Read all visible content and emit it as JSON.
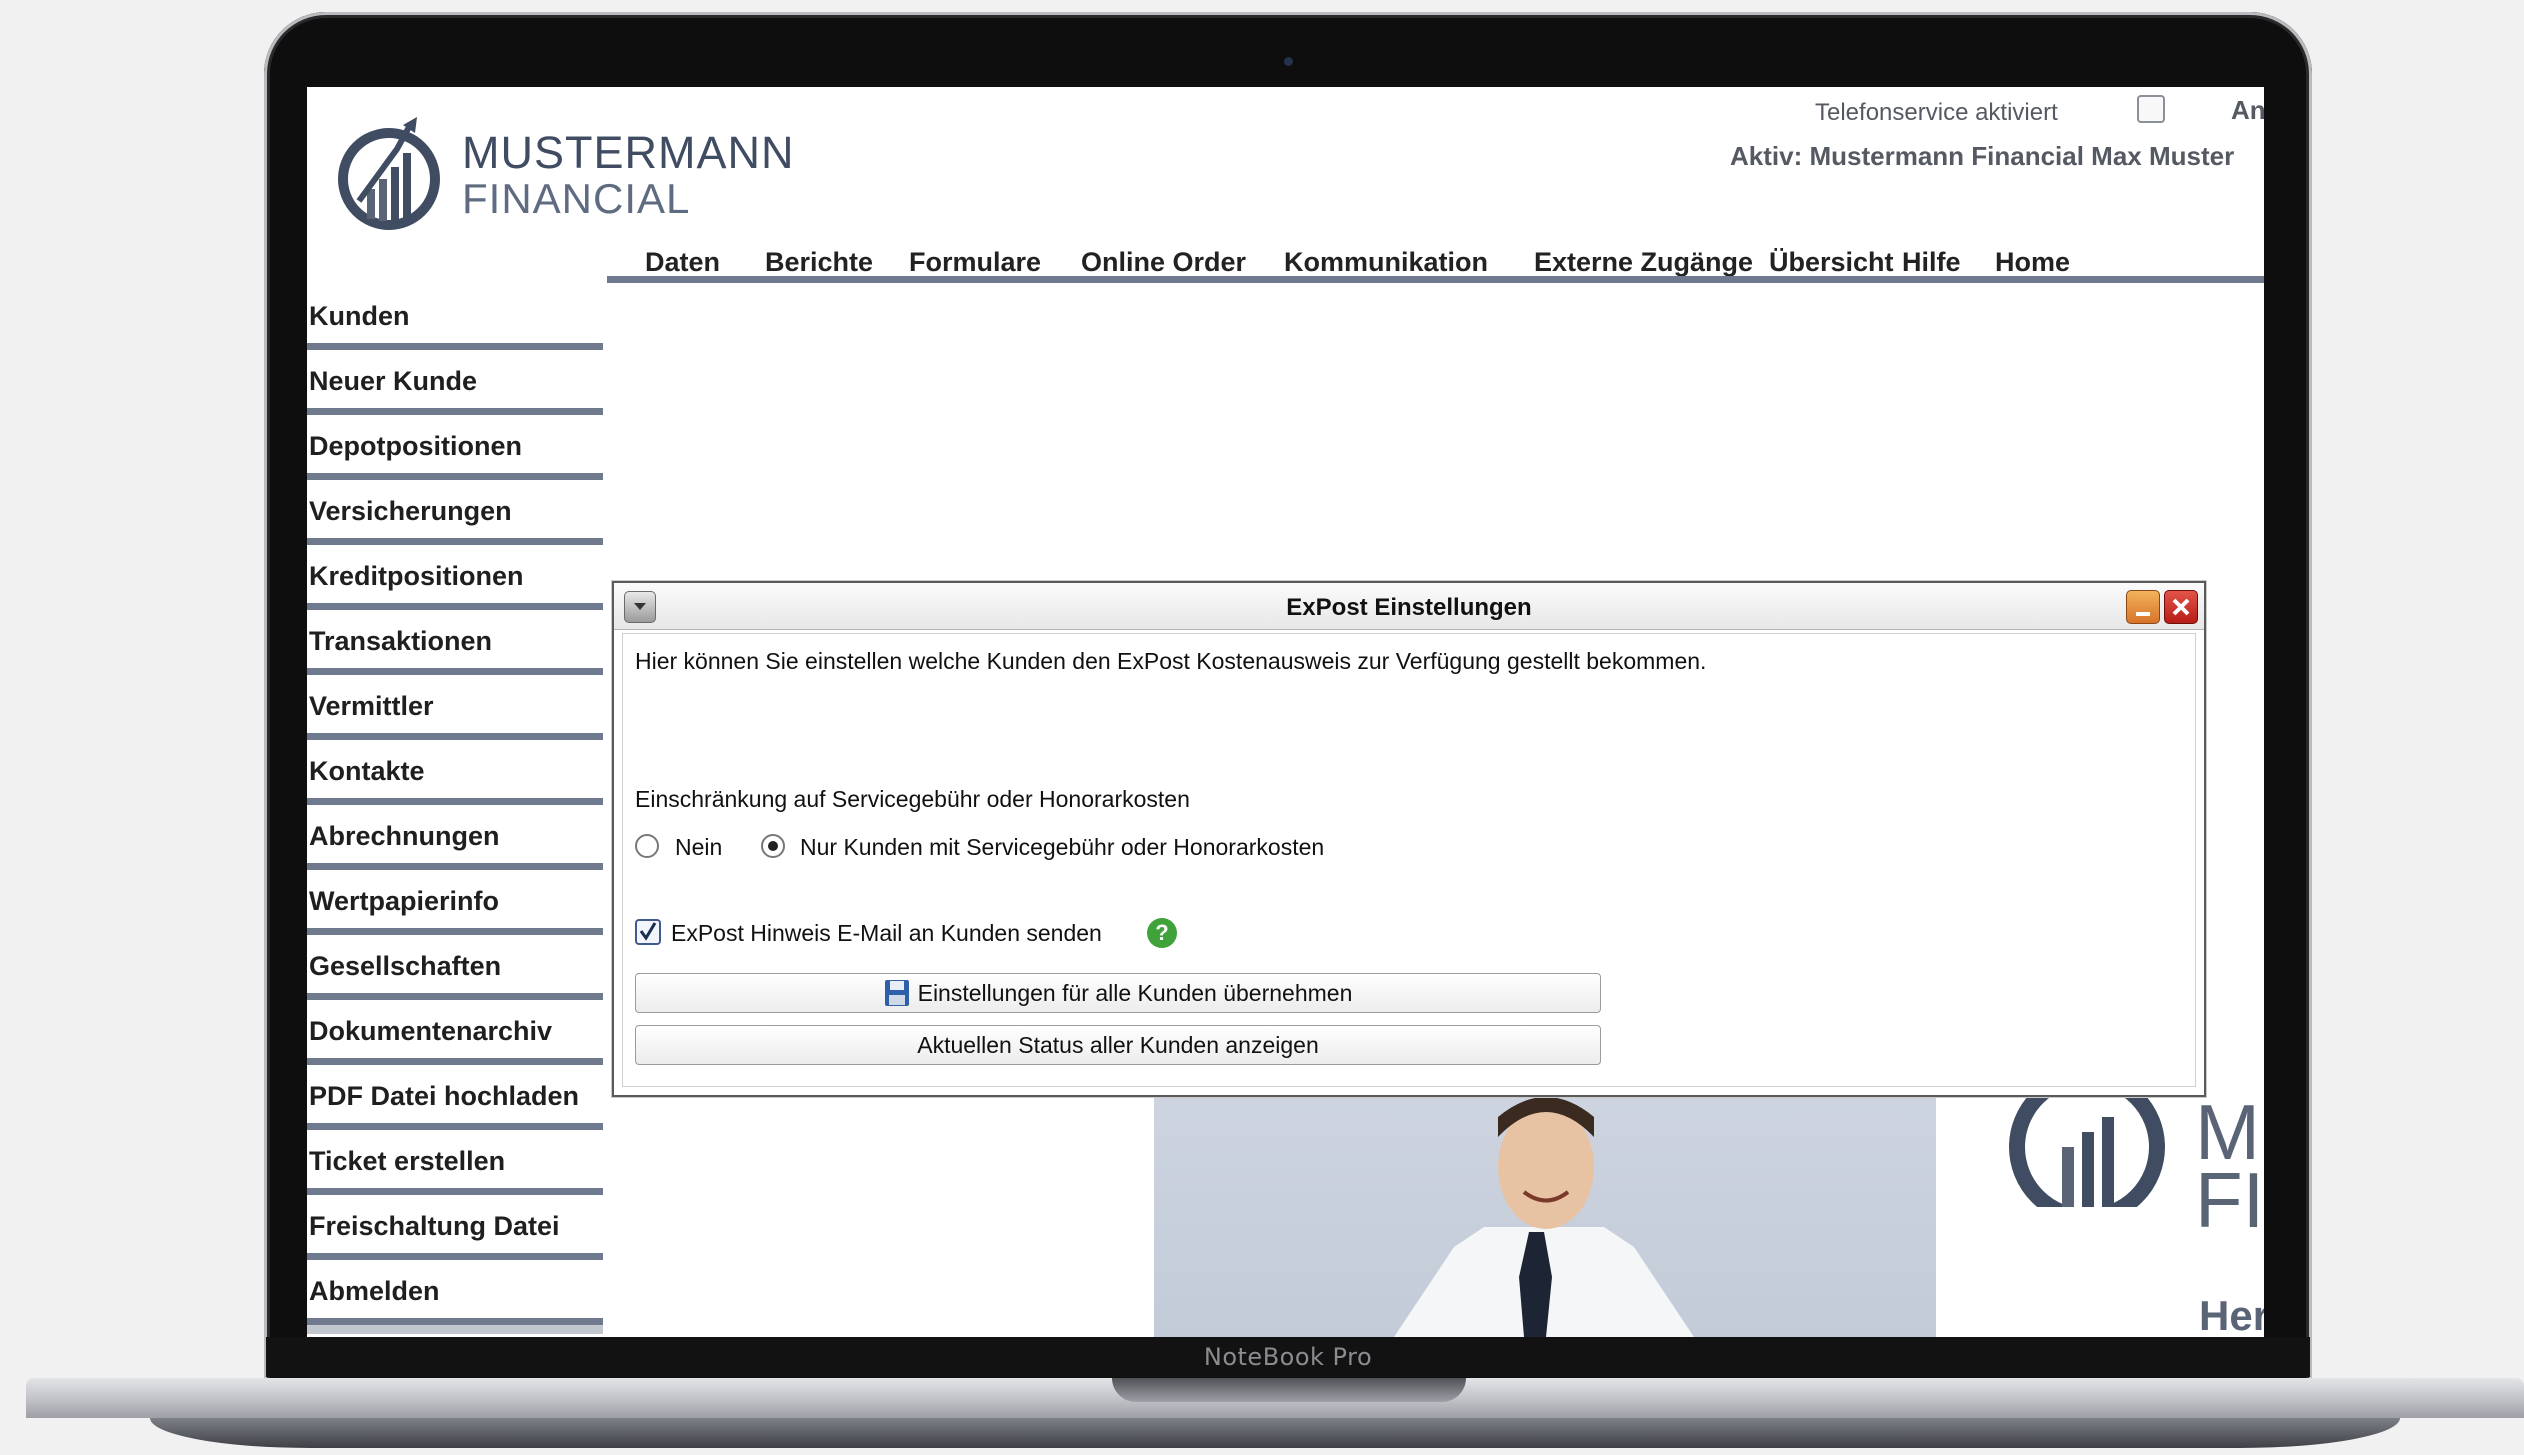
{
  "device": {
    "brand": "NoteBook Pro"
  },
  "header": {
    "logo_line1": "MUSTERMANN",
    "logo_line2": "FINANCIAL",
    "telefonservice_label": "Telefonservice aktiviert",
    "telefonservice_checked": false,
    "extra_label": "An",
    "active_user": "Aktiv: Mustermann Financial Max Muster"
  },
  "topnav": [
    "Daten",
    "Berichte",
    "Formulare",
    "Online Order",
    "Kommunikation",
    "Externe Zugänge",
    "Übersicht",
    "Hilfe",
    "Home"
  ],
  "sidebar": [
    "Kunden",
    "Neuer Kunde",
    "Depotpositionen",
    "Versicherungen",
    "Kreditpositionen",
    "Transaktionen",
    "Vermittler",
    "Kontakte",
    "Abrechnungen",
    "Wertpapierinfo",
    "Gesellschaften",
    "Dokumentenarchiv",
    "PDF Datei hochladen",
    "Ticket erstellen",
    "Freischaltung Datei",
    "Abmelden"
  ],
  "background": {
    "mini_logo_1": "MU",
    "mini_logo_2": "FI",
    "greeting": "Her"
  },
  "dialog": {
    "title": "ExPost Einstellungen",
    "description": "Hier können Sie einstellen welche Kunden den ExPost Kostenausweis zur Verfügung gestellt bekommen.",
    "restriction_label": "Einschränkung auf Servicegebühr oder Honorarkosten",
    "radio_no": "Nein",
    "radio_yes": "Nur Kunden mit Servicegebühr oder Honorarkosten",
    "selected_option": "Nur Kunden mit Servicegebühr oder Honorarkosten",
    "email_checkbox_label": "ExPost Hinweis E-Mail an Kunden senden",
    "email_checkbox_checked": true,
    "help_glyph": "?",
    "apply_button": "Einstellungen für alle Kunden übernehmen",
    "status_button": "Aktuellen Status aller Kunden anzeigen"
  },
  "colors": {
    "nav_line": "#6f7a8e",
    "logo_dark": "#3f4c62",
    "minimize": "#d7742a",
    "close": "#b71d17",
    "help": "#3fa33a"
  }
}
